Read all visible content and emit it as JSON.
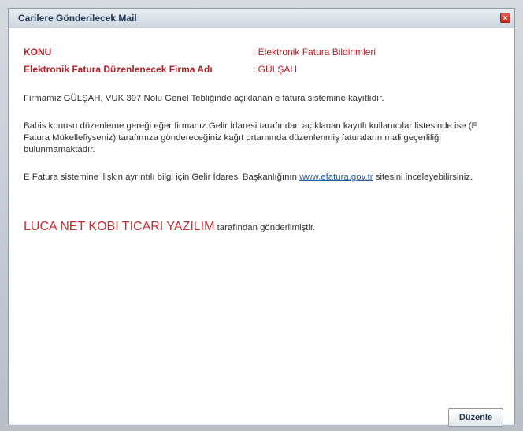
{
  "window": {
    "title": "Carilere Gönderilecek Mail",
    "close_icon": "×"
  },
  "fields": {
    "subject_label": "KONU",
    "subject_value": ":  Elektronik Fatura Bildirimleri",
    "company_label": "Elektronik Fatura Düzenlenecek Firma Adı",
    "company_value": ":  GÜLŞAH"
  },
  "body": {
    "p1": "Firmamız GÜLŞAH, VUK 397 Nolu Genel Tebliğinde açıklanan e fatura sistemine kayıtlıdır.",
    "p2": "Bahis konusu düzenleme gereği eğer firmanız Gelir İdaresi tarafından açıklanan kayıtlı kullanıcılar listesinde ise (E Fatura Mükellefiyseniz) tarafımıza göndereceğiniz kağıt ortamında düzenlenmiş faturaların mali geçerliliği bulunmamaktadır.",
    "p3_before": "E Fatura sistemine ilişkin ayrıntılı bilgi için Gelir İdaresi Başkanlığının ",
    "p3_link": "www.efatura.gov.tr",
    "p3_after": " sitesini inceleyebilirsiniz.",
    "signature_brand": "LUCA NET KOBI TICARI YAZILIM",
    "signature_rest": " tarafından gönderilmiştir."
  },
  "footer": {
    "edit_button": "Düzenle"
  }
}
